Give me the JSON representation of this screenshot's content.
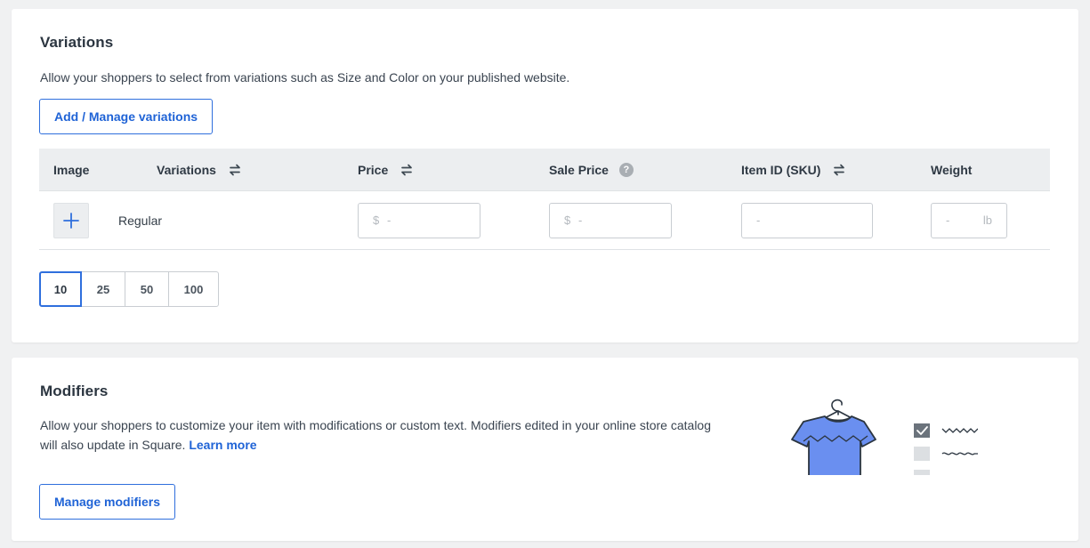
{
  "variations": {
    "title": "Variations",
    "description": "Allow your shoppers to select from variations such as Size and Color on your published website.",
    "manage_button": "Add / Manage variations",
    "columns": {
      "image": "Image",
      "variations": "Variations",
      "price": "Price",
      "sale_price": "Sale Price",
      "sku": "Item ID (SKU)",
      "weight": "Weight"
    },
    "rows": [
      {
        "name": "Regular",
        "price_prefix": "$",
        "price_placeholder": "-",
        "sale_prefix": "$",
        "sale_placeholder": "-",
        "sku_placeholder": "-",
        "weight_placeholder": "-",
        "weight_unit": "lb"
      }
    ],
    "page_sizes": [
      "10",
      "25",
      "50",
      "100"
    ],
    "selected_page_size": "10"
  },
  "modifiers": {
    "title": "Modifiers",
    "description": "Allow your shoppers to customize your item with modifications or custom text. Modifiers edited in your online store catalog will also update in Square.",
    "learn_more": "Learn more",
    "manage_button": "Manage modifiers"
  },
  "icons": {
    "sort": "sort-arrows-icon",
    "help": "help-question-icon",
    "add": "plus-icon",
    "illustration": "tshirt-checklist-illustration"
  },
  "colors": {
    "accent": "#2f6fdd",
    "link": "#1f63d6",
    "shirt": "#6a8ff0",
    "header_bg": "#eceef0"
  }
}
